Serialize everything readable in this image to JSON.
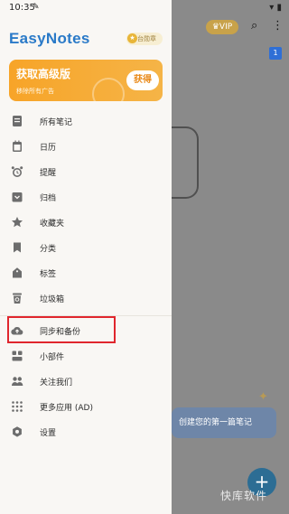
{
  "status_bar": {
    "time": "10:35"
  },
  "background": {
    "vip_label": "VIP",
    "empty_hint": "创建您的第一篇笔记",
    "fab_symbol": "+"
  },
  "watermark": "快库软件",
  "drawer": {
    "app_name": "EasyNotes",
    "badge_text": "台勋章",
    "promo": {
      "title": "获取高级版",
      "subtitle": "移除所有广告",
      "button": "获得"
    },
    "menu": [
      {
        "label": "所有笔记",
        "icon": "notes-icon"
      },
      {
        "label": "日历",
        "icon": "calendar-icon"
      },
      {
        "label": "提醒",
        "icon": "alarm-icon"
      },
      {
        "label": "归档",
        "icon": "archive-icon"
      },
      {
        "label": "收藏夹",
        "icon": "star-icon"
      },
      {
        "label": "分类",
        "icon": "bookmark-icon"
      },
      {
        "label": "标签",
        "icon": "tag-icon"
      },
      {
        "label": "垃圾箱",
        "icon": "trash-icon"
      },
      {
        "label": "同步和备份",
        "icon": "cloud-upload-icon"
      },
      {
        "label": "小部件",
        "icon": "widgets-icon"
      },
      {
        "label": "关注我们",
        "icon": "people-icon"
      },
      {
        "label": "更多应用 (AD)",
        "icon": "apps-grid-icon"
      },
      {
        "label": "设置",
        "icon": "settings-icon"
      }
    ]
  },
  "colors": {
    "brand_blue": "#2a7ac8",
    "promo_orange": "#f7a428",
    "highlight_red": "#e0262d"
  }
}
